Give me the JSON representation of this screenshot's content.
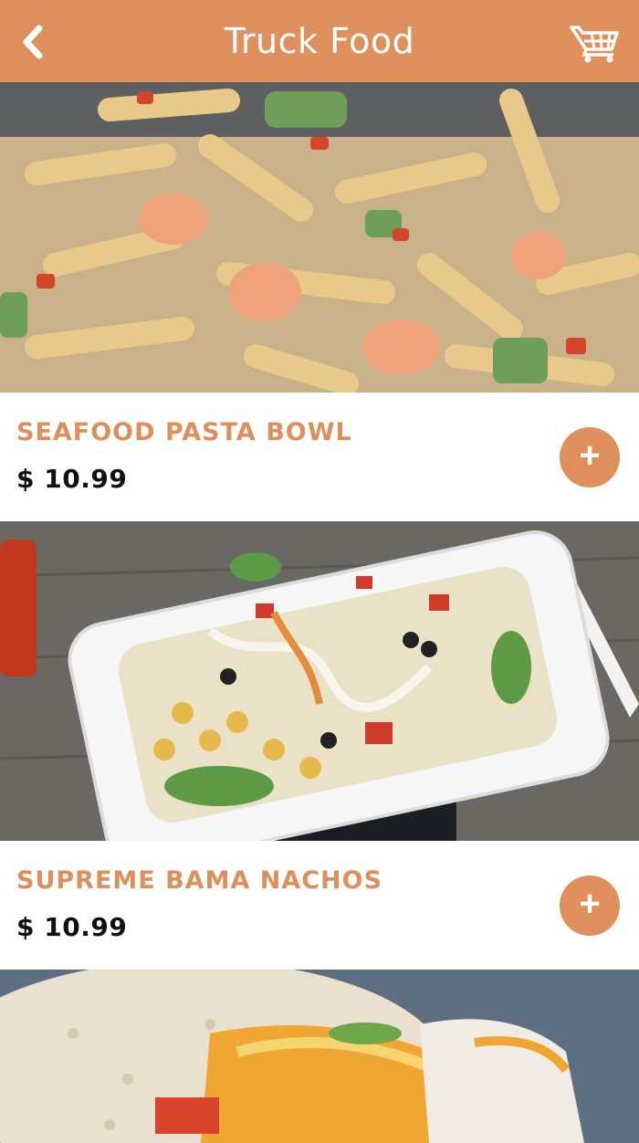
{
  "header": {
    "title": "Truck Food",
    "back_icon": "chevron-left-icon",
    "cart_icon": "shopping-cart-icon"
  },
  "colors": {
    "accent": "#E0905C",
    "price_text": "#111111"
  },
  "menu_items": [
    {
      "name": "SEAFOOD PASTA BOWL",
      "price": "$ 10.99",
      "add_icon": "plus-icon"
    },
    {
      "name": "SUPREME BAMA NACHOS",
      "price": "$ 10.99",
      "add_icon": "plus-icon"
    }
  ]
}
